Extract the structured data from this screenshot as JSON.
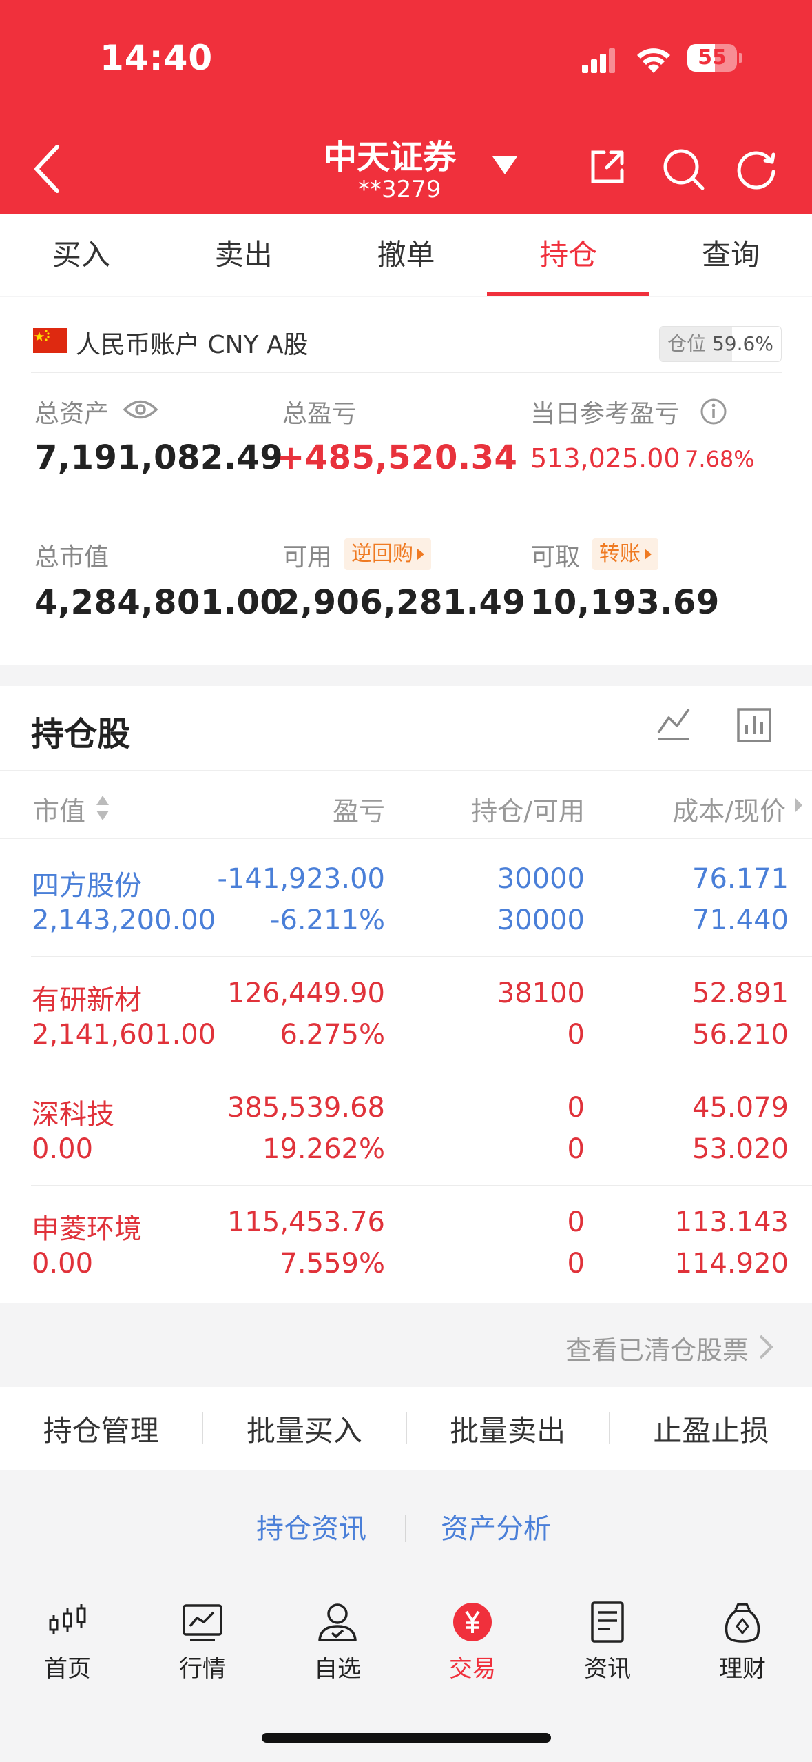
{
  "status": {
    "time": "14:40",
    "battery": "55",
    "battery_level": 0.55
  },
  "header": {
    "title": "中天证券",
    "account": "**3279"
  },
  "tabs": [
    "买入",
    "卖出",
    "撤单",
    "持仓",
    "查询"
  ],
  "account": {
    "name": "人民币账户 CNY A股",
    "position_label": "仓位",
    "position_value": "59.6%",
    "position_ratio": 0.596,
    "total_assets_label": "总资产",
    "total_assets": "7,191,082.49",
    "total_pnl_label": "总盈亏",
    "total_pnl": "+485,520.34",
    "today_pnl_label": "当日参考盈亏",
    "today_pnl": "513,025.00",
    "today_pnl_pct": "7.68%",
    "market_value_label": "总市值",
    "market_value": "4,284,801.00",
    "available_label": "可用",
    "available_tag": "逆回购",
    "available": "2,906,281.49",
    "withdrawable_label": "可取",
    "withdrawable_tag": "转账",
    "withdrawable": "10,193.69"
  },
  "holdings": {
    "title": "持仓股",
    "columns": [
      "市值",
      "盈亏",
      "持仓/可用",
      "成本/现价"
    ],
    "rows": [
      {
        "name": "四方股份",
        "market_value": "2,143,200.00",
        "pnl": "-141,923.00",
        "pnl_pct": "-6.211%",
        "position": "30000",
        "available": "30000",
        "cost": "76.171",
        "price": "71.440",
        "color": "#4a7fd8"
      },
      {
        "name": "有研新材",
        "market_value": "2,141,601.00",
        "pnl": "126,449.90",
        "pnl_pct": "6.275%",
        "position": "38100",
        "available": "0",
        "cost": "52.891",
        "price": "56.210",
        "color": "#e0323a"
      },
      {
        "name": "深科技",
        "market_value": "0.00",
        "pnl": "385,539.68",
        "pnl_pct": "19.262%",
        "position": "0",
        "available": "0",
        "cost": "45.079",
        "price": "53.020",
        "color": "#e0323a"
      },
      {
        "name": "申菱环境",
        "market_value": "0.00",
        "pnl": "115,453.76",
        "pnl_pct": "7.559%",
        "position": "0",
        "available": "0",
        "cost": "113.143",
        "price": "114.920",
        "color": "#e0323a"
      }
    ]
  },
  "cleared_link": "查看已清仓股票",
  "actions": [
    "持仓管理",
    "批量买入",
    "批量卖出",
    "止盈止损"
  ],
  "links": [
    "持仓资讯",
    "资产分析"
  ],
  "tabbar": [
    {
      "label": "首页",
      "icon": "candlestick-icon"
    },
    {
      "label": "行情",
      "icon": "chart-icon"
    },
    {
      "label": "自选",
      "icon": "user-check-icon"
    },
    {
      "label": "交易",
      "icon": "yuan-icon"
    },
    {
      "label": "资讯",
      "icon": "document-icon"
    },
    {
      "label": "理财",
      "icon": "money-bag-icon"
    }
  ]
}
